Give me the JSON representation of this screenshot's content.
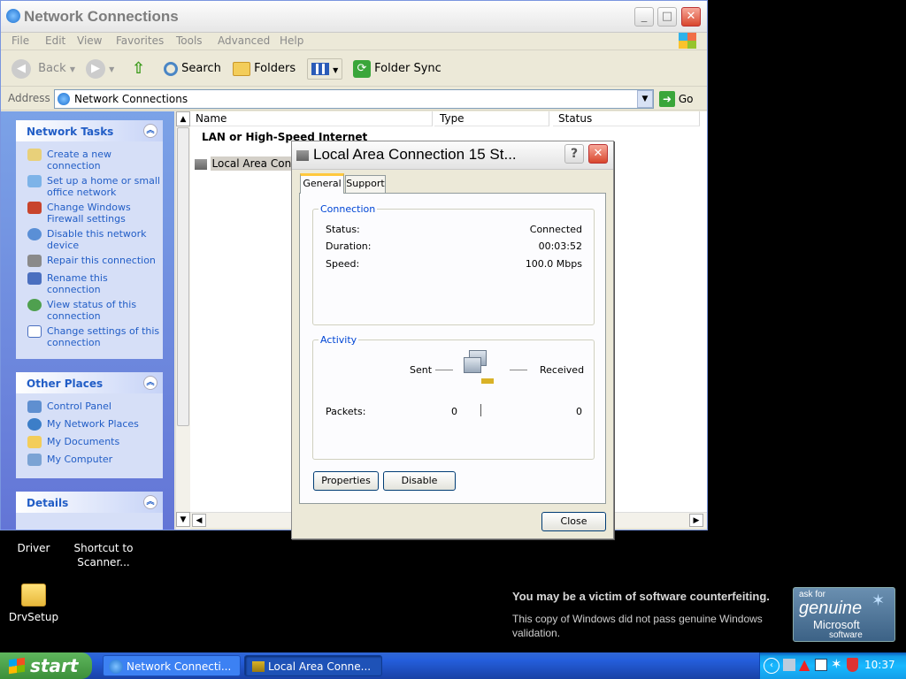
{
  "desktop": {
    "icons": [
      {
        "label": "Driver"
      },
      {
        "label": "Shortcut to Scanner..."
      },
      {
        "label": "DrvSetup"
      }
    ]
  },
  "window": {
    "title": "Network Connections",
    "menu": [
      "File",
      "Edit",
      "View",
      "Favorites",
      "Tools",
      "Advanced",
      "Help"
    ],
    "toolbar": {
      "back": "Back",
      "search": "Search",
      "folders": "Folders",
      "folder_sync": "Folder Sync"
    },
    "address": {
      "label": "Address",
      "value": "Network Connections",
      "go": "Go"
    },
    "network_tasks": {
      "title": "Network Tasks",
      "items": [
        "Create a new connection",
        "Set up a home or small office network",
        "Change Windows Firewall settings",
        "Disable this network device",
        "Repair this connection",
        "Rename this connection",
        "View status of this connection",
        "Change settings of this connection"
      ]
    },
    "other_places": {
      "title": "Other Places",
      "items": [
        "Control Panel",
        "My Network Places",
        "My Documents",
        "My Computer"
      ]
    },
    "details": {
      "title": "Details"
    },
    "columns": [
      "Name",
      "Type",
      "Status"
    ],
    "group_header": "LAN or High-Speed Internet",
    "list_item": "Local Area Conn"
  },
  "dialog": {
    "title": "Local Area Connection 15 St...",
    "tabs": [
      "General",
      "Support"
    ],
    "connection": {
      "legend": "Connection",
      "status_label": "Status:",
      "status_value": "Connected",
      "duration_label": "Duration:",
      "duration_value": "00:03:52",
      "speed_label": "Speed:",
      "speed_value": "100.0 Mbps"
    },
    "activity": {
      "legend": "Activity",
      "sent": "Sent",
      "received": "Received",
      "packets_label": "Packets:",
      "packets_sent": "0",
      "packets_received": "0"
    },
    "properties_button": "Properties",
    "disable_button": "Disable",
    "close_button": "Close"
  },
  "genuine": {
    "headline": "You may be a victim of software counterfeiting.",
    "body": "This copy of Windows did not pass genuine Windows validation.",
    "badge_top": "ask for",
    "badge_main": "genuine",
    "badge_brand": "Microsoft",
    "badge_sub": "software"
  },
  "taskbar": {
    "start": "start",
    "tasks": [
      "Network Connecti...",
      "Local Area Conne..."
    ],
    "clock": "10:37"
  }
}
